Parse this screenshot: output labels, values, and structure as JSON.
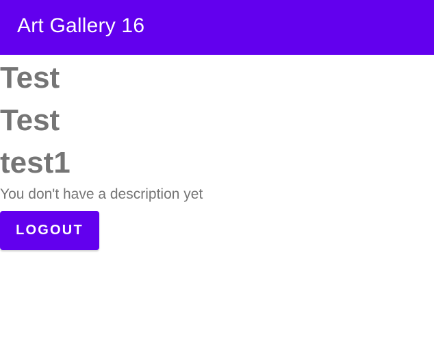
{
  "app_bar": {
    "title": "Art Gallery 16",
    "color": "#6200ee"
  },
  "profile": {
    "first_name": "Test",
    "last_name": "Test",
    "username": "test1",
    "description": "You don't have a description yet"
  },
  "actions": {
    "logout_label": "LOGOUT"
  },
  "colors": {
    "primary": "#6200ee",
    "text_secondary": "#757575",
    "on_primary": "#ffffff"
  }
}
